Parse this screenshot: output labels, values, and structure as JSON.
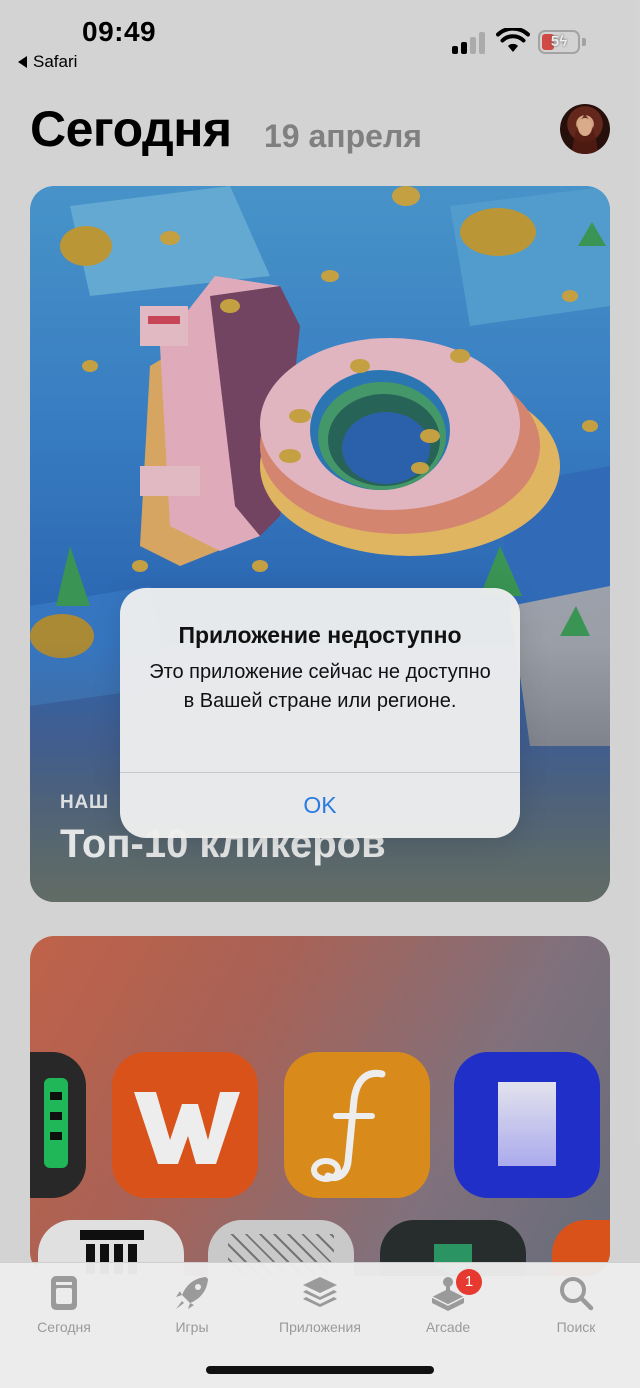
{
  "status_bar": {
    "time": "09:49",
    "back_app": "Safari",
    "battery_level": "5",
    "battery_charging": true,
    "signal_bars_active": 2,
    "signal_bars_total": 4
  },
  "header": {
    "title": "Сегодня",
    "date": "19 апреля"
  },
  "featured_card": {
    "eyebrow": "НАШ",
    "title": "Топ-10 кликеров"
  },
  "alert": {
    "title": "Приложение недоступно",
    "message": "Это приложение сейчас не доступно в Вашей стране или регионе.",
    "button": "OK"
  },
  "tab_bar": {
    "tabs": [
      {
        "label": "Сегодня",
        "icon": "today-icon"
      },
      {
        "label": "Игры",
        "icon": "rocket-icon"
      },
      {
        "label": "Приложения",
        "icon": "layers-icon"
      },
      {
        "label": "Arcade",
        "icon": "arcade-icon",
        "badge": "1"
      },
      {
        "label": "Поиск",
        "icon": "search-icon"
      }
    ]
  },
  "colors": {
    "accent": "#2a7be0",
    "badge": "#e6392f",
    "battery_low": "#e14f4a"
  }
}
